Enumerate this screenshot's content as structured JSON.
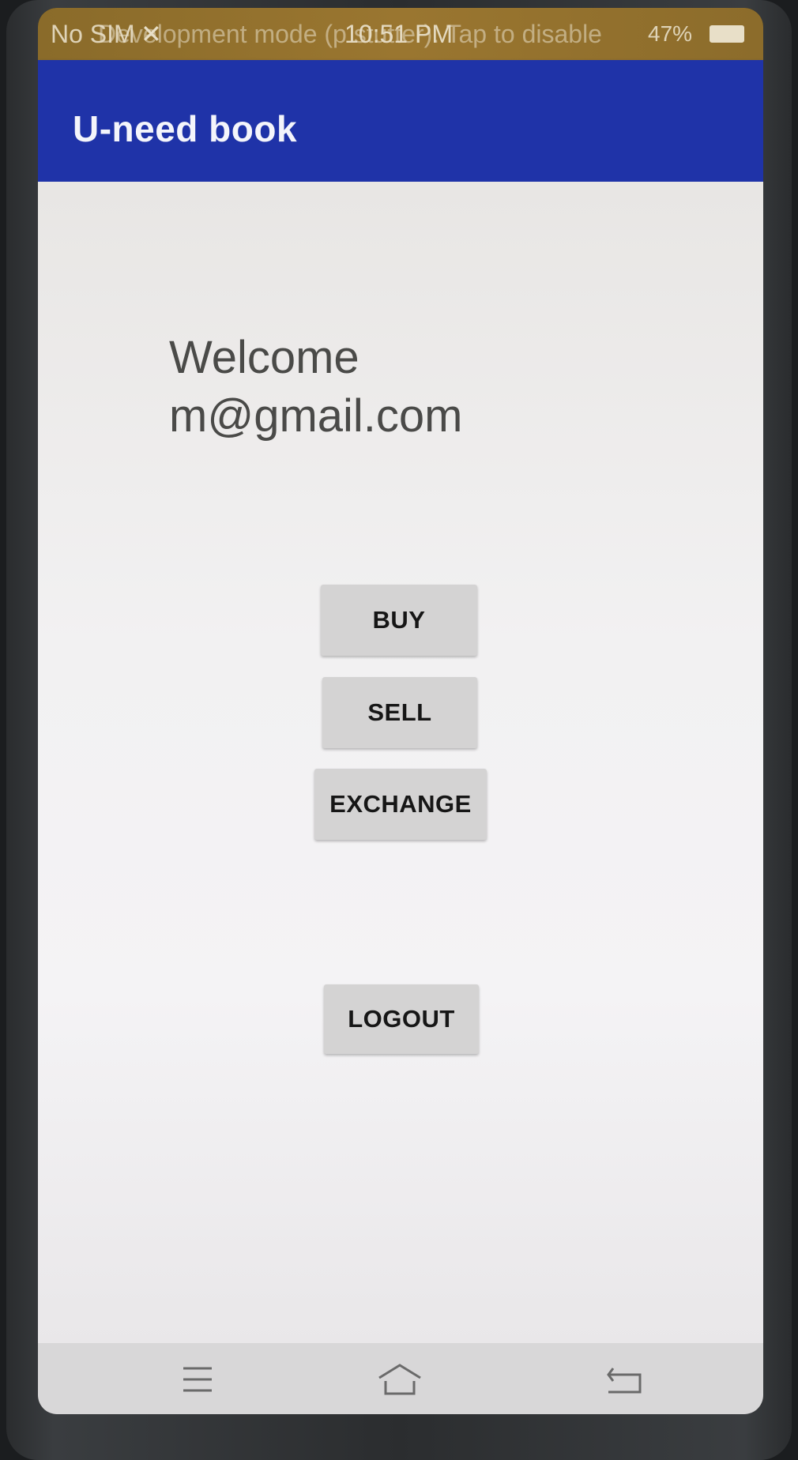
{
  "status_bar": {
    "sim": "No SIM",
    "dev_message": "Development mode (p   stutter). Tap to disable",
    "time": "10:51 PM",
    "battery": "47%"
  },
  "app_bar": {
    "title": "U-need book"
  },
  "main": {
    "welcome_line1": "Welcome",
    "welcome_line2": "m@gmail.com",
    "buttons": {
      "buy": "BUY",
      "sell": "SELL",
      "exchange": "EXCHANGE",
      "logout": "LOGOUT"
    }
  },
  "nav_bar": {
    "icons": [
      "menu-icon",
      "home-icon",
      "back-icon"
    ]
  },
  "colors": {
    "app_bar": "#1f33a8",
    "status_bar": "#9a7630",
    "button_bg": "#d4d3d3",
    "background": "#f2f1f2"
  }
}
